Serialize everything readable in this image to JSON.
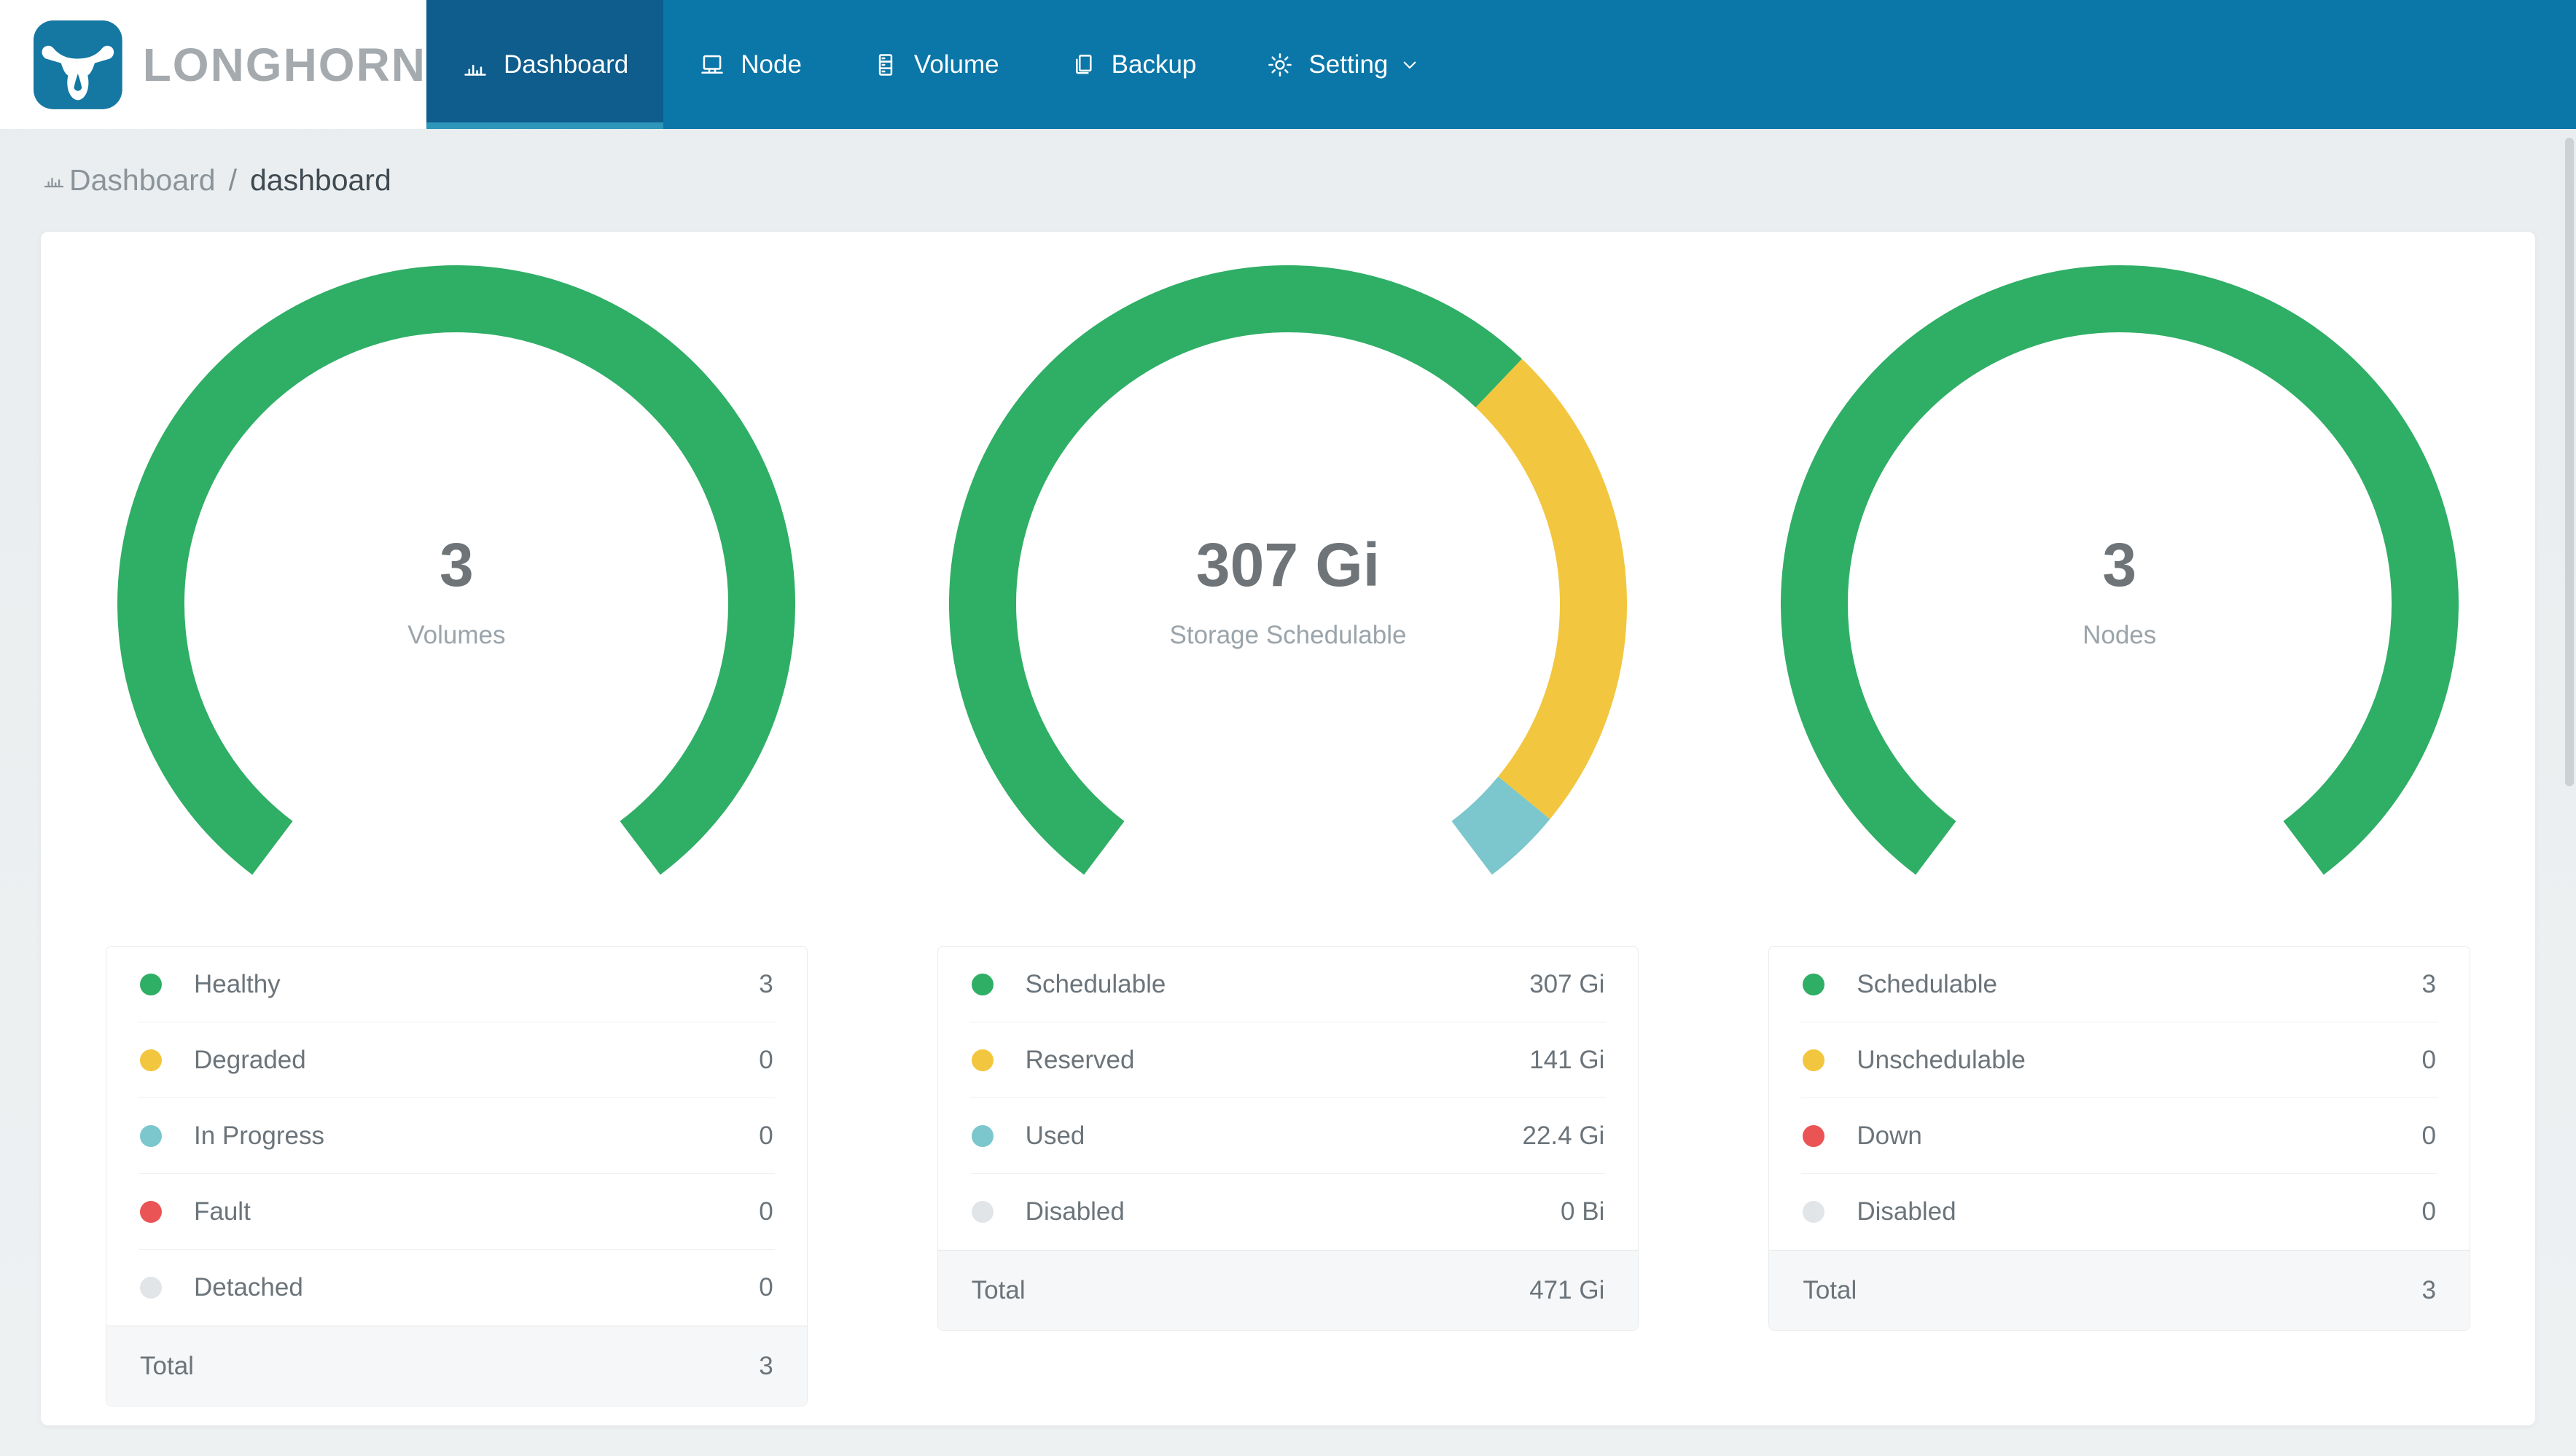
{
  "header": {
    "logo_text": "LONGHORN",
    "nav_items": [
      {
        "label": "Dashboard",
        "icon": "bar-chart",
        "active": true,
        "caret": false
      },
      {
        "label": "Node",
        "icon": "laptop",
        "active": false,
        "caret": false
      },
      {
        "label": "Volume",
        "icon": "database",
        "active": false,
        "caret": false
      },
      {
        "label": "Backup",
        "icon": "copy",
        "active": false,
        "caret": false
      },
      {
        "label": "Setting",
        "icon": "gear",
        "active": false,
        "caret": true
      }
    ]
  },
  "breadcrumb": {
    "section": "Dashboard",
    "separator": "/",
    "page": "dashboard"
  },
  "colors": {
    "nav_bg": "#0b76a8",
    "nav_active_bg": "#0e5d8d",
    "nav_active_indicator": "#2e96b9",
    "logo_blue": "#1578a2",
    "green": "#2fae66",
    "yellow": "#f2c63e",
    "teal": "#7cc6cd",
    "red": "#ea5455",
    "gray": "#e2e5e8"
  },
  "chart_data": [
    {
      "type": "gauge",
      "title": "Volumes",
      "center_value": "3",
      "center_label": "Volumes",
      "arc_span_deg": 286,
      "segments": [
        {
          "label": "Healthy",
          "value": 3,
          "display": "3",
          "color": "#2fae66"
        },
        {
          "label": "Degraded",
          "value": 0,
          "display": "0",
          "color": "#f2c63e"
        },
        {
          "label": "In Progress",
          "value": 0,
          "display": "0",
          "color": "#7cc6cd"
        },
        {
          "label": "Fault",
          "value": 0,
          "display": "0",
          "color": "#ea5455"
        },
        {
          "label": "Detached",
          "value": 0,
          "display": "0",
          "color": "#e2e5e8"
        }
      ],
      "total": {
        "label": "Total",
        "display": "3"
      }
    },
    {
      "type": "gauge",
      "title": "Storage Schedulable",
      "center_value": "307 Gi",
      "center_label": "Storage Schedulable",
      "arc_span_deg": 286,
      "segments": [
        {
          "label": "Schedulable",
          "value": 307,
          "display": "307 Gi",
          "color": "#2fae66"
        },
        {
          "label": "Reserved",
          "value": 141,
          "display": "141 Gi",
          "color": "#f2c63e"
        },
        {
          "label": "Used",
          "value": 22.4,
          "display": "22.4 Gi",
          "color": "#7cc6cd"
        },
        {
          "label": "Disabled",
          "value": 0,
          "display": "0 Bi",
          "color": "#e2e5e8"
        }
      ],
      "total": {
        "label": "Total",
        "display": "471 Gi"
      }
    },
    {
      "type": "gauge",
      "title": "Nodes",
      "center_value": "3",
      "center_label": "Nodes",
      "arc_span_deg": 286,
      "segments": [
        {
          "label": "Schedulable",
          "value": 3,
          "display": "3",
          "color": "#2fae66"
        },
        {
          "label": "Unschedulable",
          "value": 0,
          "display": "0",
          "color": "#f2c63e"
        },
        {
          "label": "Down",
          "value": 0,
          "display": "0",
          "color": "#ea5455"
        },
        {
          "label": "Disabled",
          "value": 0,
          "display": "0",
          "color": "#e2e5e8"
        }
      ],
      "total": {
        "label": "Total",
        "display": "3"
      }
    }
  ]
}
